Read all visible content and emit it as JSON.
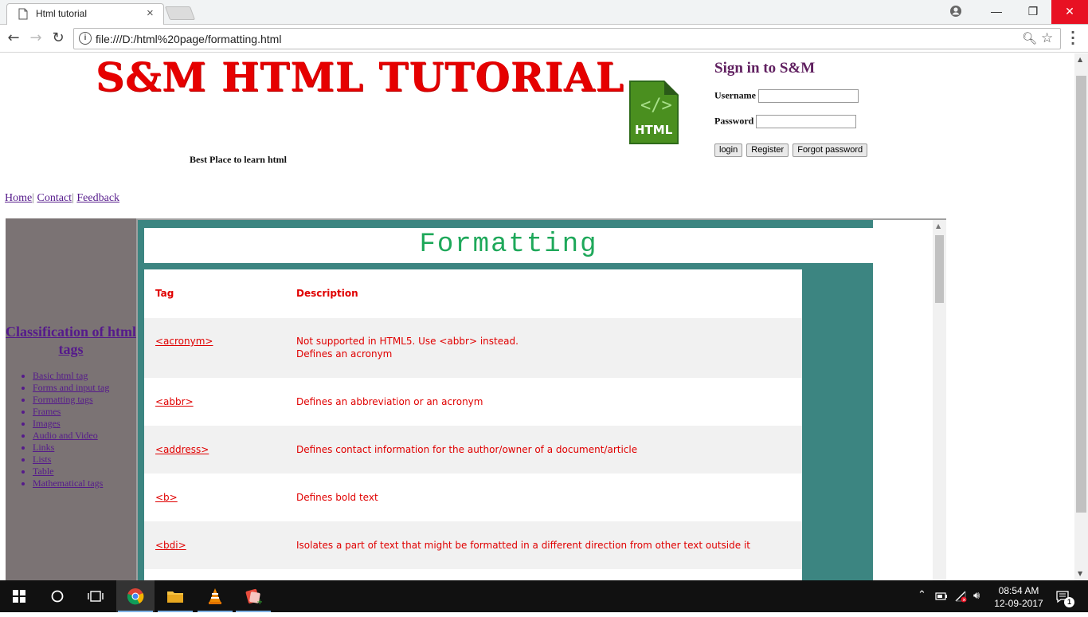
{
  "browser": {
    "tab_title": "Html tutorial",
    "tab_close": "×",
    "url": "file:///D:/html%20page/formatting.html",
    "window_controls": {
      "minimize": "—",
      "restore": "❐",
      "close": "✕"
    }
  },
  "header": {
    "site_title": "S&M HTML TUTORIAL",
    "tagline": "Best Place to learn html",
    "logo_text": "HTML"
  },
  "signin": {
    "title": "Sign in to S&M",
    "username_label": "Username",
    "password_label": "Password",
    "buttons": [
      "login",
      "Register",
      "Forgot password"
    ]
  },
  "topnav": {
    "links": [
      "Home",
      "Contact",
      "Feedback"
    ],
    "separator": "|"
  },
  "sidebar": {
    "heading": "Classification of html tags",
    "items": [
      "Basic html tag",
      "Forms and input tag",
      "Formatting tags",
      "Frames",
      "Images",
      "Audio and Video",
      "Links",
      "Lists",
      "Table",
      "Mathematical tags"
    ]
  },
  "content": {
    "banner": "Formatting",
    "columns": [
      "Tag",
      "Description"
    ],
    "rows": [
      {
        "tag": "<acronym>",
        "desc1": "Not supported in HTML5. Use <abbr> instead.",
        "desc2": "Defines an acronym"
      },
      {
        "tag": "<abbr>",
        "desc1": "Defines an abbreviation or an acronym",
        "desc2": ""
      },
      {
        "tag": "<address>",
        "desc1": "Defines contact information for the author/owner of a document/article",
        "desc2": ""
      },
      {
        "tag": "<b>",
        "desc1": "Defines bold text",
        "desc2": ""
      },
      {
        "tag": "<bdi>",
        "desc1": "Isolates a part of text that might be formatted in a different direction from other text outside it",
        "desc2": ""
      }
    ]
  },
  "taskbar": {
    "time": "08:54 AM",
    "date": "12-09-2017",
    "notification_count": "1"
  },
  "colors": {
    "title_red": "#e60000",
    "teal": "#3c8581",
    "sidebar_gray": "#7b7374",
    "banner_green": "#1ea85a",
    "close_red": "#e81123"
  }
}
